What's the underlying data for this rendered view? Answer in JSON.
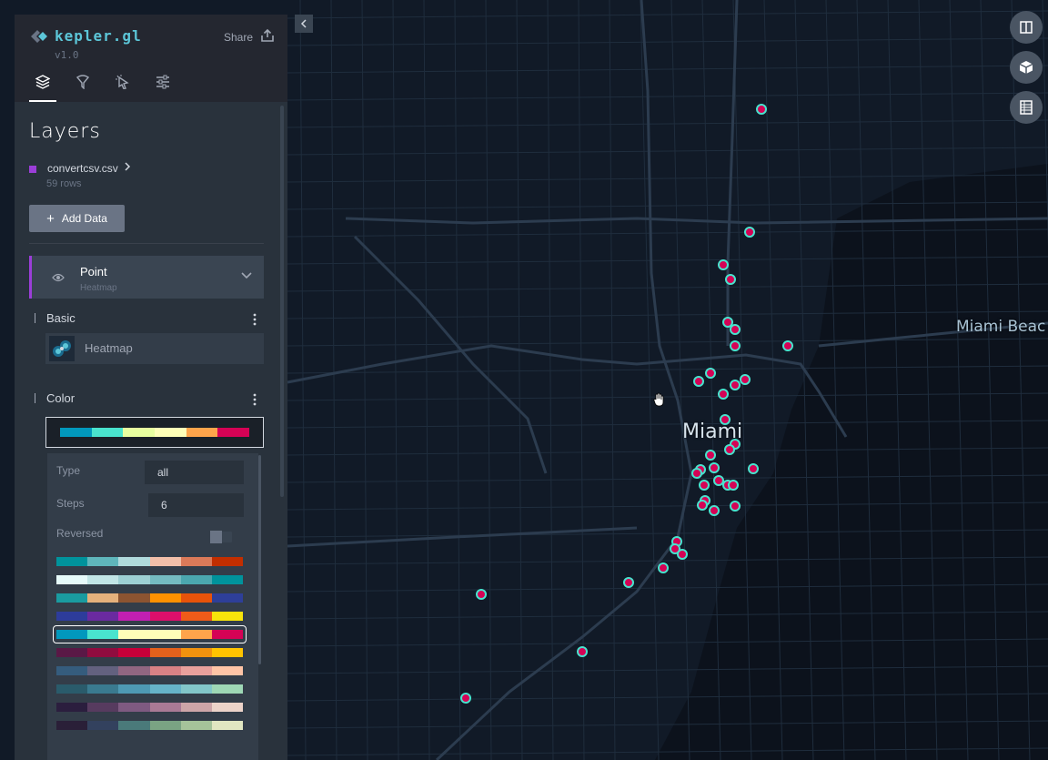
{
  "app": {
    "logo_text": "kepler.gl",
    "version": "v1.0",
    "share_label": "Share"
  },
  "tabs": [
    {
      "icon": "layers-icon",
      "active": true
    },
    {
      "icon": "filter-icon",
      "active": false
    },
    {
      "icon": "interaction-icon",
      "active": false
    },
    {
      "icon": "map-settings-icon",
      "active": false
    }
  ],
  "layers_panel": {
    "title": "Layers",
    "dataset": {
      "name": "convertcsv.csv",
      "rows": "59 rows",
      "color": "#9b3ed8"
    },
    "add_data_label": "Add Data"
  },
  "layer": {
    "name": "Point",
    "type_label": "Heatmap"
  },
  "basic": {
    "title": "Basic",
    "vis_type": "Heatmap"
  },
  "color": {
    "title": "Color",
    "selected_palette": [
      "#0198bd",
      "#49e3ce",
      "#e8fea0",
      "#fefeb8",
      "#fea44b",
      "#d50255"
    ],
    "type_label": "Type",
    "type_value": "all",
    "steps_label": "Steps",
    "steps_value": "6",
    "reversed_label": "Reversed",
    "reversed_on": false,
    "palettes": [
      [
        "#00939c",
        "#5fb6bb",
        "#b0dadc",
        "#f2bfa9",
        "#db7a59",
        "#c22e00"
      ],
      [
        "#e6fafa",
        "#c1e5e6",
        "#9dd0d4",
        "#75bbc1",
        "#4ba7af",
        "#00939c"
      ],
      [
        "#1a9ba0",
        "#e5b17c",
        "#8c5431",
        "#fe9100",
        "#e8530a",
        "#2e3f99"
      ],
      [
        "#2d3c9b",
        "#6a2aa0",
        "#c11fb2",
        "#dc0f6b",
        "#ef5b19",
        "#f8e40b"
      ],
      [
        "#0198bd",
        "#49e3ce",
        "#fefeb8",
        "#fefeb8",
        "#fea44b",
        "#d50255"
      ],
      [
        "#5a1846",
        "#900c3f",
        "#c70039",
        "#e3611c",
        "#f1920e",
        "#ffc300"
      ],
      [
        "#355c7d",
        "#63617f",
        "#916681",
        "#d88185",
        "#e8a09c",
        "#fec4a6"
      ],
      [
        "#2a5b6b",
        "#3a7a8f",
        "#4e99b3",
        "#66b3c8",
        "#82c6c9",
        "#9ed7b5"
      ],
      [
        "#2b1e3e",
        "#573b5f",
        "#7e5a81",
        "#a97a95",
        "#cda5a8",
        "#ecd3c9"
      ],
      [
        "#2a1f38",
        "#33415e",
        "#4a7a7a",
        "#7aa383",
        "#a5c39a",
        "#e1e6c1"
      ]
    ],
    "selected_index": 4
  },
  "map": {
    "labels": {
      "miami": "Miami",
      "miami_beach": "Miami Beac"
    },
    "controls": [
      "split-map-icon",
      "3d-map-icon",
      "legend-icon"
    ]
  }
}
